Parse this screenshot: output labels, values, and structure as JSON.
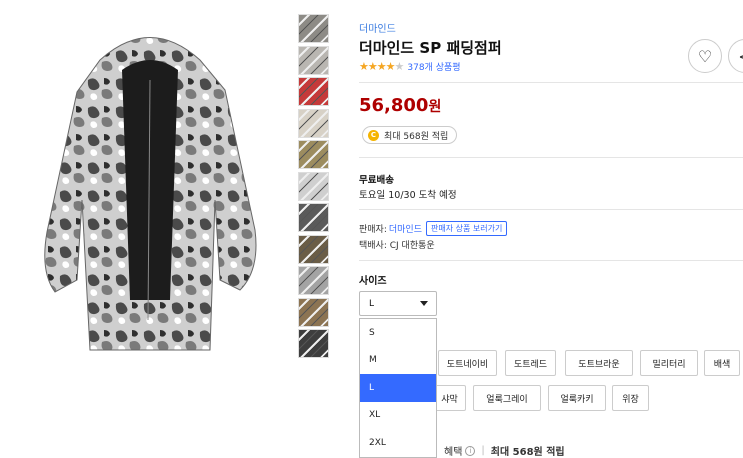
{
  "product": {
    "brand": "더마인드",
    "title": "더마인드 SP 패딩점퍼",
    "rating": 4.5,
    "review_count": "378개 상품평",
    "price": "56,800",
    "price_unit": "원",
    "reward": "최대 568원 적립",
    "reward_coin_symbol": "C"
  },
  "shipping": {
    "title": "무료배송",
    "date": "토요일 10/30 도착 예정"
  },
  "seller": {
    "label": "판매자:",
    "name": "더마인드",
    "more_button": "판매자 상품 보러가기",
    "courier": "택배사: CJ 대한통운"
  },
  "size": {
    "label": "사이즈",
    "selected": "L",
    "options": [
      "S",
      "M",
      "L",
      "XL",
      "2XL"
    ]
  },
  "colors": {
    "row1": [
      "도트네이비",
      "도트레드",
      "도트브라운",
      "밀리터리",
      "배색"
    ],
    "row2": [
      "샤막",
      "얼룩그레이",
      "얼룩카키",
      "위장"
    ]
  },
  "benefit": {
    "label": "혜택",
    "text": "최대 568원 적립"
  },
  "icons": {
    "heart": "heart-icon",
    "share": "share-icon",
    "star": "star-icon",
    "coin": "coin-icon",
    "caret": "chevron-down-icon"
  },
  "thumbnail_colors": [
    "#8d8b86",
    "#b9b6b1",
    "#c53a3a",
    "#d7d1c6",
    "#9c8c5f",
    "#cfcfcf",
    "#5a5a5a",
    "#6a5d47",
    "#a3a3a3",
    "#8c7453",
    "#3e3e3e"
  ],
  "accent_color": "#346aff",
  "price_color": "#ae0000"
}
